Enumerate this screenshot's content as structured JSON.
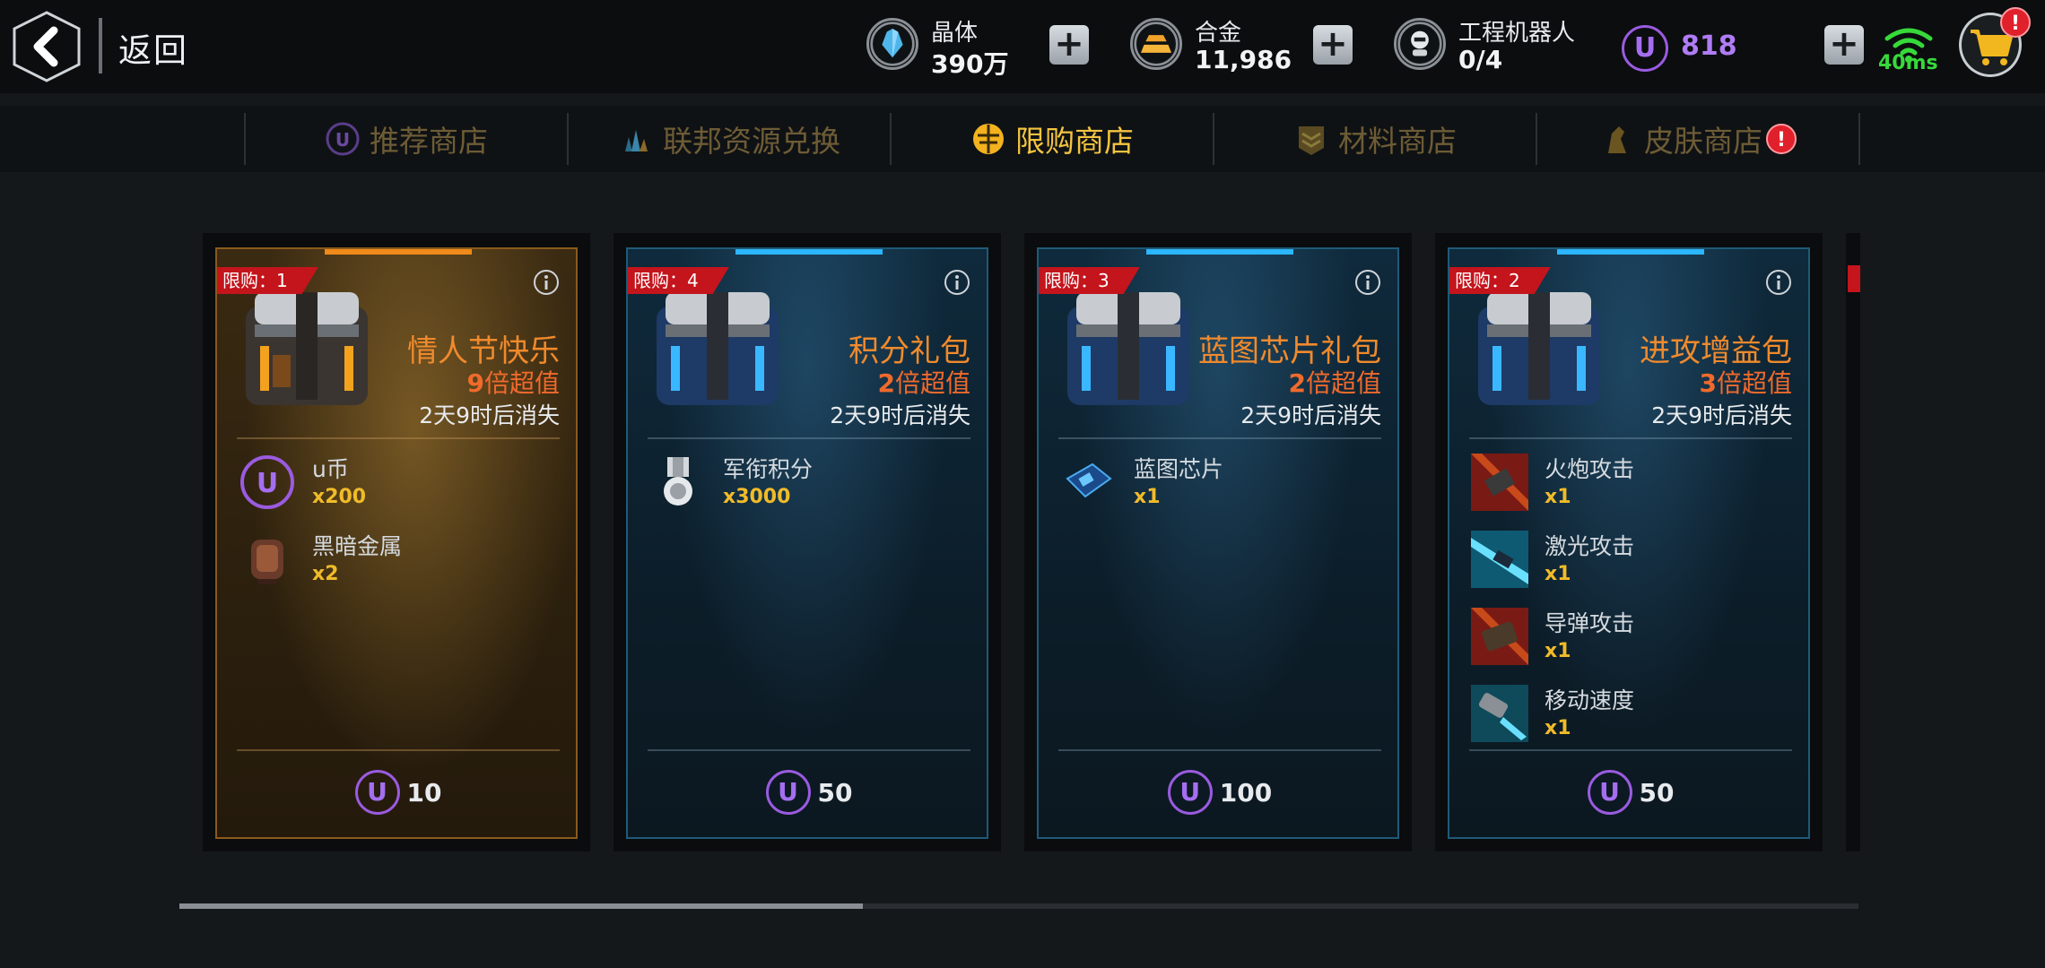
{
  "header": {
    "back_label": "返回",
    "resources": [
      {
        "name": "晶体",
        "value": "390万",
        "icon": "crystal-icon"
      },
      {
        "name": "合金",
        "value": "11,986",
        "icon": "alloy-icon"
      },
      {
        "name": "工程机器人",
        "value": "0/4",
        "icon": "robot-icon"
      }
    ],
    "ucoin": {
      "symbol": "U",
      "value": "818"
    },
    "plus_symbol": "+",
    "ping": "40ms",
    "cart_badge": "!"
  },
  "tabs": [
    {
      "label": "推荐商店",
      "icon": "u-coin-icon",
      "active": false
    },
    {
      "label": "联邦资源兑换",
      "icon": "crystals-icon",
      "active": false
    },
    {
      "label": "限购商店",
      "icon": "limited-shop-icon",
      "active": true
    },
    {
      "label": "材料商店",
      "icon": "chevron-rank-icon",
      "active": false
    },
    {
      "label": "皮肤商店",
      "icon": "skin-icon",
      "active": false,
      "badge": "!"
    }
  ],
  "cards": [
    {
      "theme": "gold",
      "limit": "限购：1",
      "title": "情人节快乐",
      "value_num": "9",
      "value_text": "倍超值",
      "timer": "2天9时后消失",
      "items": [
        {
          "name": "u币",
          "qty": "x200",
          "icon": "u-coin-icon"
        },
        {
          "name": "黑暗金属",
          "qty": "x2",
          "icon": "dark-metal-icon"
        }
      ],
      "price": "10"
    },
    {
      "theme": "blue",
      "limit": "限购：4",
      "title": "积分礼包",
      "value_num": "2",
      "value_text": "倍超值",
      "timer": "2天9时后消失",
      "items": [
        {
          "name": "军衔积分",
          "qty": "x3000",
          "icon": "medal-icon"
        }
      ],
      "price": "50"
    },
    {
      "theme": "blue",
      "limit": "限购：3",
      "title": "蓝图芯片礼包",
      "value_num": "2",
      "value_text": "倍超值",
      "timer": "2天9时后消失",
      "items": [
        {
          "name": "蓝图芯片",
          "qty": "x1",
          "icon": "chip-icon"
        }
      ],
      "price": "100"
    },
    {
      "theme": "blue",
      "limit": "限购：2",
      "title": "进攻增益包",
      "value_num": "3",
      "value_text": "倍超值",
      "timer": "2天9时后消失",
      "items": [
        {
          "name": "火炮攻击",
          "qty": "x1",
          "icon": "cannon-icon"
        },
        {
          "name": "激光攻击",
          "qty": "x1",
          "icon": "laser-icon"
        },
        {
          "name": "导弹攻击",
          "qty": "x1",
          "icon": "missile-icon"
        },
        {
          "name": "移动速度",
          "qty": "x1",
          "icon": "speed-icon"
        }
      ],
      "price": "50"
    }
  ],
  "colors": {
    "accent_gold": "#f3c440",
    "ucoin_purple": "#a56ef0",
    "limit_red": "#c4141c",
    "qty_yellow": "#f0bb2a"
  }
}
